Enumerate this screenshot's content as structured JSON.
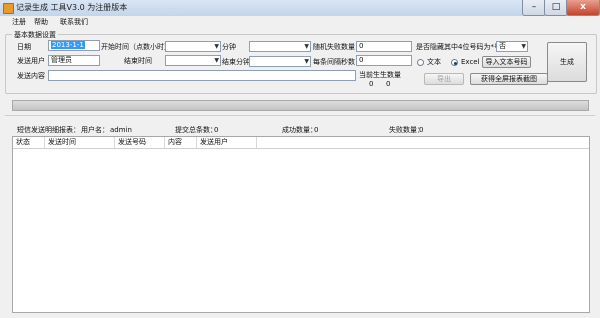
{
  "window": {
    "title": "记录生成 工具V3.0 为注册版本",
    "ghost_text": "...... ....... ..........",
    "minimize": "–",
    "maximize": "□",
    "close": "x"
  },
  "menu": [
    "注册",
    "帮助",
    "联系我们"
  ],
  "settings": {
    "group_title": "基本数据设置",
    "date_label": "日期",
    "date_value": "2013-1-1",
    "start_time_label": "开始时间（点数小时）",
    "start_time_value": "",
    "minute_label": "分钟",
    "minute_value": "",
    "random_fail_label": "随机失败数量",
    "random_fail_value": "0",
    "hide_mid_label": "是否隐藏其中4位号码为*号",
    "hide_mid_value": "否",
    "sender_label": "发送用户",
    "sender_value": "管理员",
    "end_time_label": "结束时间",
    "end_time_value": "",
    "end_minute_label": "结束分钟",
    "end_minute_value": "",
    "interval_label": "每条间隔秒数",
    "interval_value": "0",
    "content_label": "发送内容",
    "content_value": "",
    "radio_text_label": "文本",
    "radio_excel_label": "Excel",
    "import_button": "导入文本号码",
    "generate_button": "生成",
    "current_gen_label": "当前生生数量",
    "current_gen_value_1": "0",
    "current_gen_value_2": "0",
    "export_button": "导出",
    "screenshot_button": "获得全屏报表截图"
  },
  "summary": {
    "report_label": "短信发送明细报表：",
    "user_label": "用户名：",
    "user_value": "admin",
    "total_label": "提交总条数：",
    "total_value": "0",
    "success_label": "成功数量：",
    "success_value": "0",
    "fail_label": "失败数量：",
    "fail_value": "0"
  },
  "table": {
    "columns": [
      "状态",
      "发送时间",
      "发送号码",
      "内容",
      "发送用户"
    ]
  },
  "colors": {
    "titlebar": "#c3d5ea",
    "close": "#c6432c",
    "selection": "#3399ff"
  }
}
